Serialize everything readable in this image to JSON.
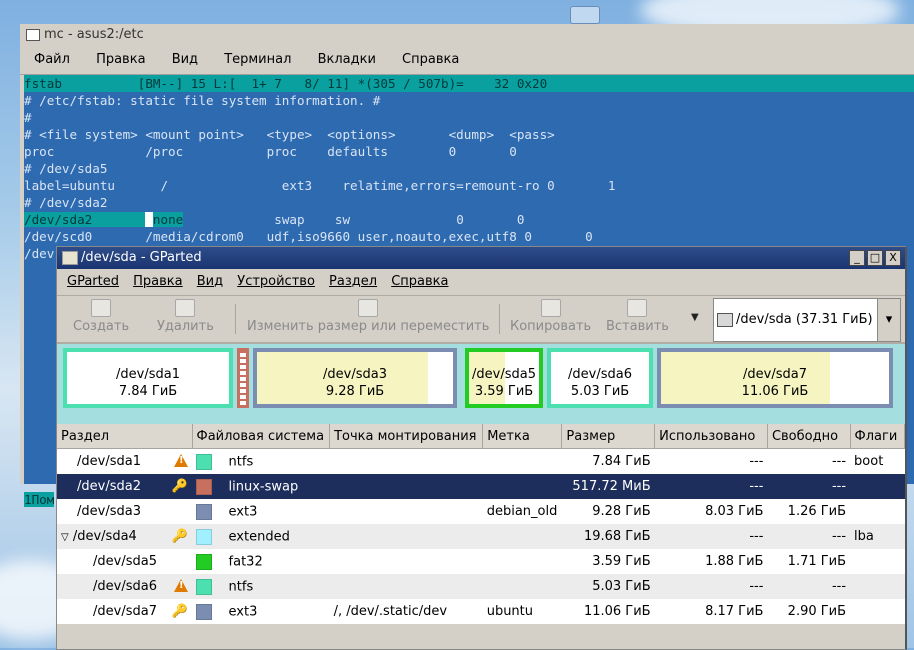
{
  "mc": {
    "title": "mc - asus2:/etc",
    "menu": [
      "Файл",
      "Правка",
      "Вид",
      "Терминал",
      "Вкладки",
      "Справка"
    ],
    "status_line": "fstab          [BM--] 15 L:[  1+ 7   8/ 11] *(305 / 507b)=    32 0x20",
    "lines": [
      "# /etc/fstab: static file system information. #",
      "#",
      "# <file system> <mount point>   <type>  <options>       <dump>  <pass>",
      "proc            /proc           proc    defaults        0       0",
      "# /dev/sda5",
      "label=ubuntu      /               ext3    relatime,errors=remount-ro 0       1",
      "# /dev/sda2"
    ],
    "edit_line": {
      "highlight": "/dev/sda2       ",
      "cursor": " ",
      "rest_hl": "none",
      "rest": "            swap    sw              0       0"
    },
    "line_cdrom": "/dev/scd0       /media/cdrom0   udf,iso9660 user,noauto,exec,utf8 0       0",
    "line_partial": "/dev",
    "bottom_fragment": "1Пом"
  },
  "gparted": {
    "title": "/dev/sda - GParted",
    "window_buttons": [
      "_",
      "□",
      "X"
    ],
    "menu": [
      "GParted",
      "Правка",
      "Вид",
      "Устройство",
      "Раздел",
      "Справка"
    ],
    "toolbar": {
      "create": "Создать",
      "delete": "Удалить",
      "resize": "Изменить размер или переместить",
      "copy": "Копировать",
      "paste": "Вставить"
    },
    "device_select": "/dev/sda   (37.31 ГиБ)",
    "map": [
      {
        "name": "/dev/sda1",
        "size": "7.84 ГиБ",
        "color": "#4ce0b0",
        "used_fraction": 0
      },
      {
        "name": "/dev/sda3",
        "size": "9.28 ГиБ",
        "color": "#7b8db0",
        "used_fraction": 0.87
      },
      {
        "name": "/dev/sda5",
        "size": "3.59 ГиБ",
        "color": "#22cc22",
        "used_fraction": 0.52
      },
      {
        "name": "/dev/sda6",
        "size": "5.03 ГиБ",
        "color": "#4ce0b0",
        "used_fraction": 0
      },
      {
        "name": "/dev/sda7",
        "size": "11.06 ГиБ",
        "color": "#7b8db0",
        "used_fraction": 0.74
      }
    ],
    "swap_color": "#c87060",
    "columns": [
      "Раздел",
      "Файловая система",
      "Точка монтирования",
      "Метка",
      "Размер",
      "Использовано",
      "Свободно",
      "Флаги"
    ],
    "rows": [
      {
        "partition": "/dev/sda1",
        "icon": "warning",
        "fs": "ntfs",
        "color": "#4ce0b0",
        "mount": "",
        "label": "",
        "size": "7.84 ГиБ",
        "used": "---",
        "free": "---",
        "flags": "boot"
      },
      {
        "partition": "/dev/sda2",
        "icon": "key",
        "fs": "linux-swap",
        "color": "#c87060",
        "mount": "",
        "label": "",
        "size": "517.72 МиБ",
        "used": "---",
        "free": "---",
        "flags": ""
      },
      {
        "partition": "/dev/sda3",
        "icon": "",
        "fs": "ext3",
        "color": "#7b8db0",
        "mount": "",
        "label": "debian_old",
        "size": "9.28 ГиБ",
        "used": "8.03 ГиБ",
        "free": "1.26 ГиБ",
        "flags": ""
      },
      {
        "partition": "/dev/sda4",
        "icon": "key",
        "fs": "extended",
        "color": "#a0f0ff",
        "mount": "",
        "label": "",
        "size": "19.68 ГиБ",
        "used": "---",
        "free": "---",
        "flags": "lba"
      },
      {
        "partition": "/dev/sda5",
        "icon": "",
        "fs": "fat32",
        "color": "#22cc22",
        "mount": "",
        "label": "",
        "size": "3.59 ГиБ",
        "used": "1.88 ГиБ",
        "free": "1.71 ГиБ",
        "flags": ""
      },
      {
        "partition": "/dev/sda6",
        "icon": "warning",
        "fs": "ntfs",
        "color": "#4ce0b0",
        "mount": "",
        "label": "",
        "size": "5.03 ГиБ",
        "used": "---",
        "free": "---",
        "flags": ""
      },
      {
        "partition": "/dev/sda7",
        "icon": "key",
        "fs": "ext3",
        "color": "#7b8db0",
        "mount": "/, /dev/.static/dev",
        "label": "ubuntu",
        "size": "11.06 ГиБ",
        "used": "8.17 ГиБ",
        "free": "2.90 ГиБ",
        "flags": ""
      }
    ],
    "selected_row": 1
  }
}
